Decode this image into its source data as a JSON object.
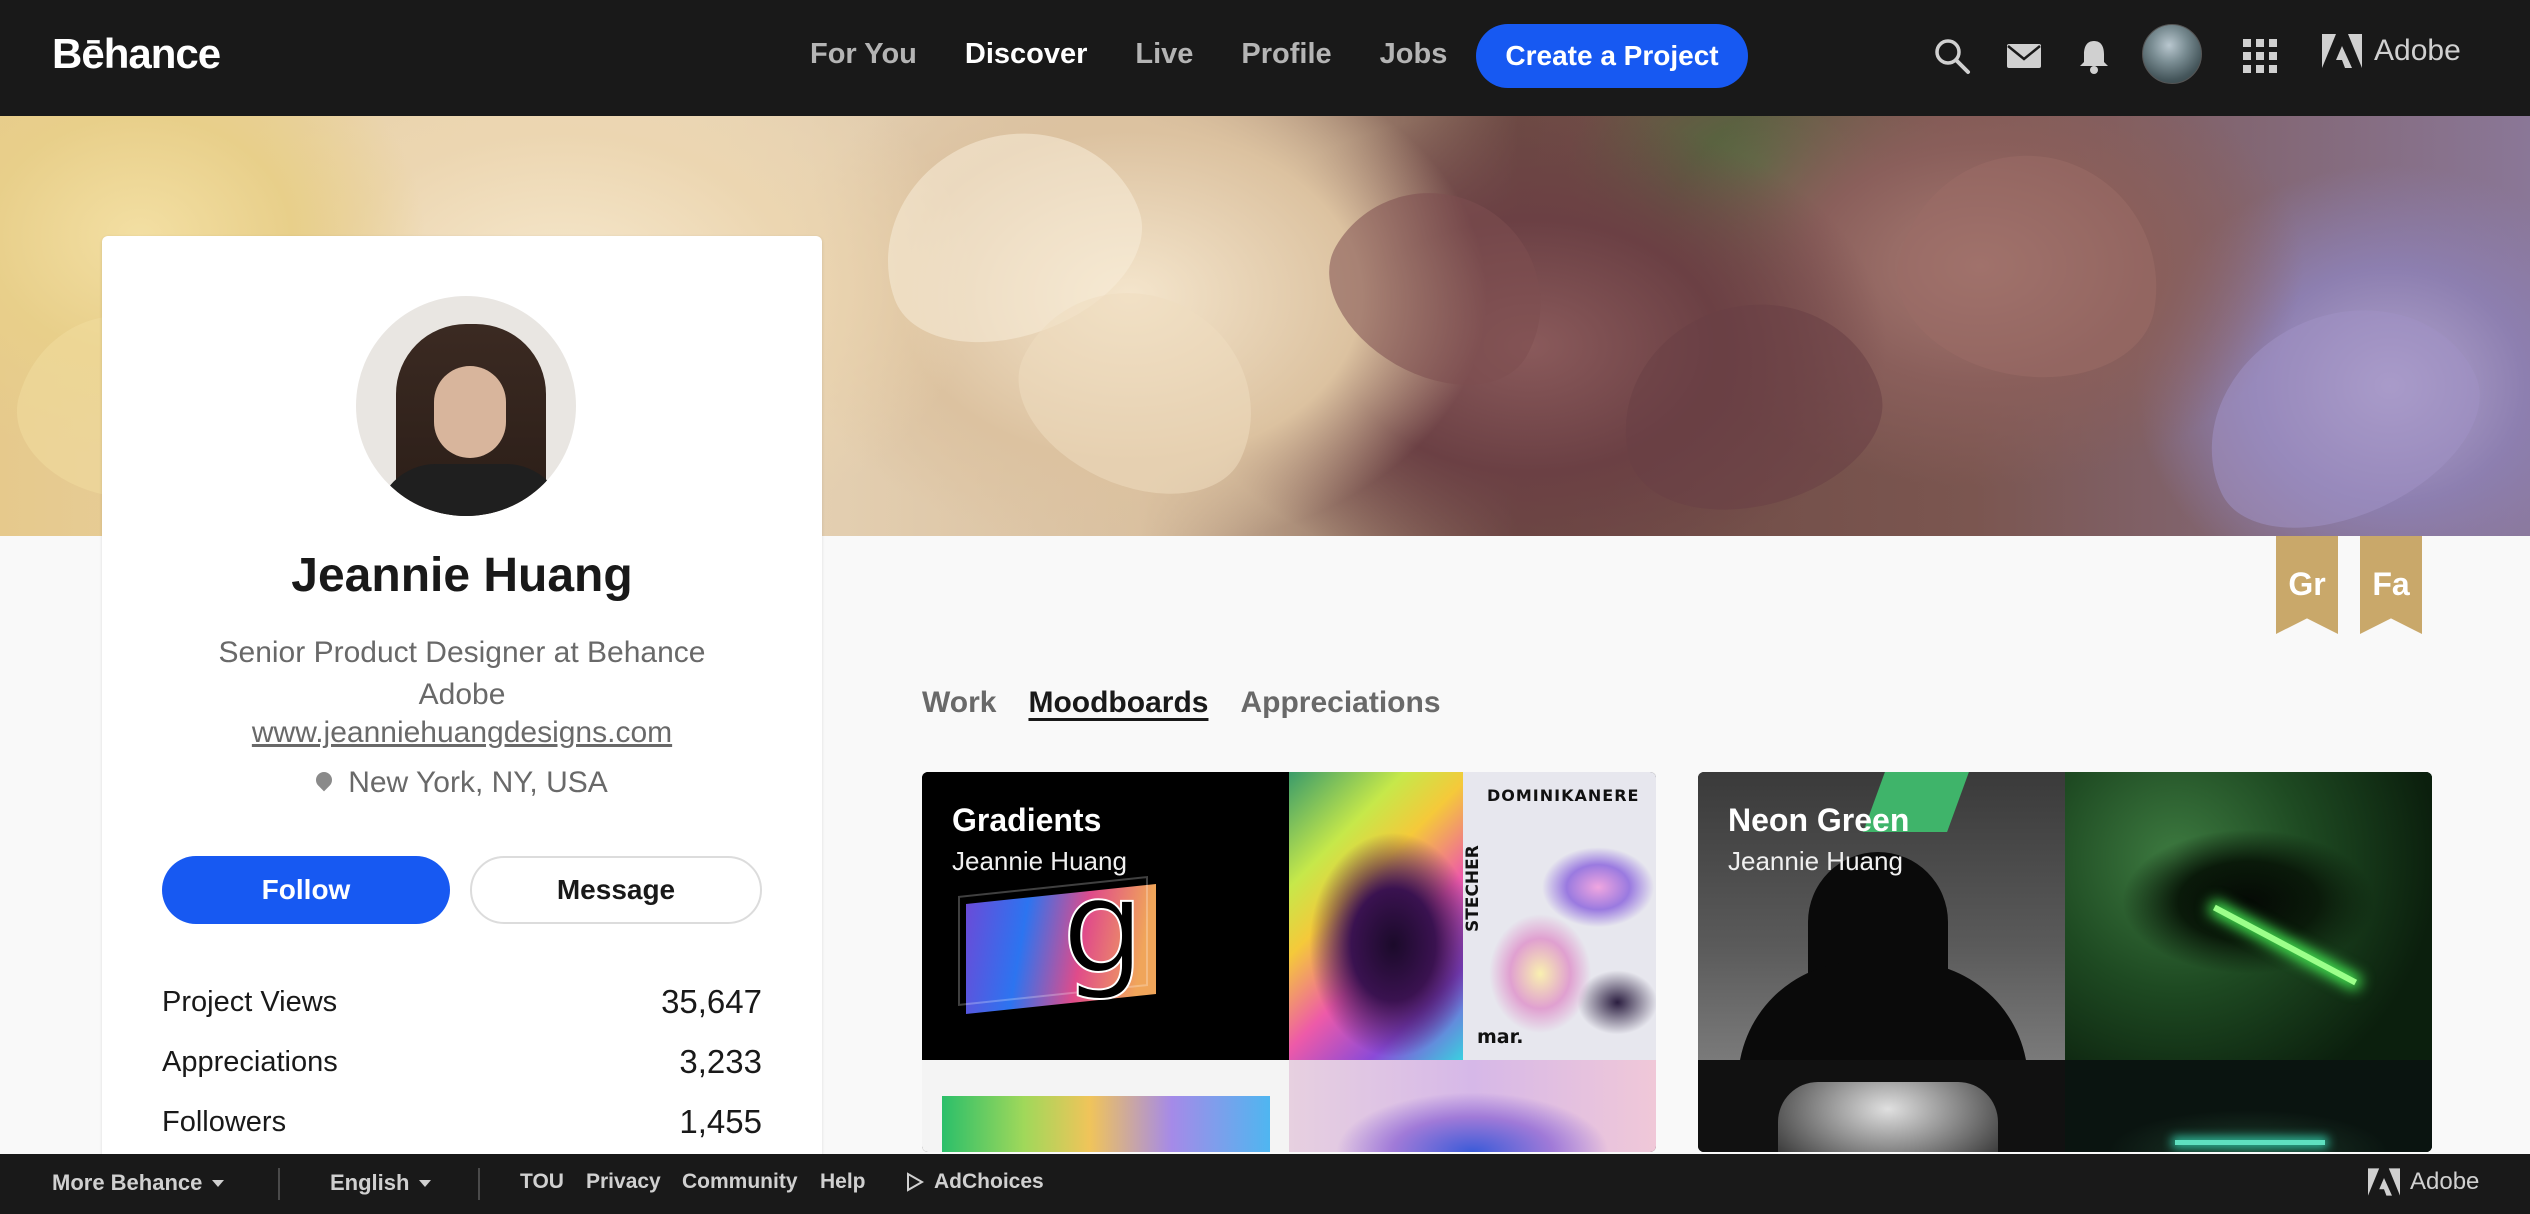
{
  "nav": {
    "logo": "Bēhance",
    "links": [
      "For You",
      "Discover",
      "Live",
      "Profile",
      "Jobs"
    ],
    "active_link": "Discover",
    "create_button": "Create a Project",
    "adobe": "Adobe",
    "icons": [
      "search-icon",
      "mail-icon",
      "bell-icon",
      "avatar",
      "apps-grid-icon",
      "adobe-icon"
    ]
  },
  "profile": {
    "name": "Jeannie Huang",
    "occupation": "Senior Product Designer at Behance Adobe",
    "website": "www.jeanniehuangdesigns.com",
    "location": "New York, NY, USA",
    "follow": "Follow",
    "message": "Message",
    "stats": [
      {
        "label": "Project Views",
        "value": "35,647"
      },
      {
        "label": "Appreciations",
        "value": "3,233"
      },
      {
        "label": "Followers",
        "value": "1,455"
      }
    ]
  },
  "badges": [
    "Gr",
    "Fa"
  ],
  "tabs": {
    "items": [
      "Work",
      "Moodboards",
      "Appreciations"
    ],
    "active": "Moodboards"
  },
  "moodboards": [
    {
      "title": "Gradients",
      "owner": "Jeannie Huang",
      "glyph": "g",
      "tile_text": [
        "DOMINIKANERE",
        "STECHER",
        "mar."
      ]
    },
    {
      "title": "Neon Green",
      "owner": "Jeannie Huang"
    }
  ],
  "footer": {
    "more": "More Behance",
    "language": "English",
    "links": [
      "TOU",
      "Privacy",
      "Community",
      "Help"
    ],
    "adchoices": "AdChoices",
    "adobe": "Adobe"
  },
  "colors": {
    "nav_bg": "#191919",
    "accent_blue": "#1759f2",
    "badge_gold": "#c9a86a",
    "page_bg": "#f9f9f9"
  }
}
